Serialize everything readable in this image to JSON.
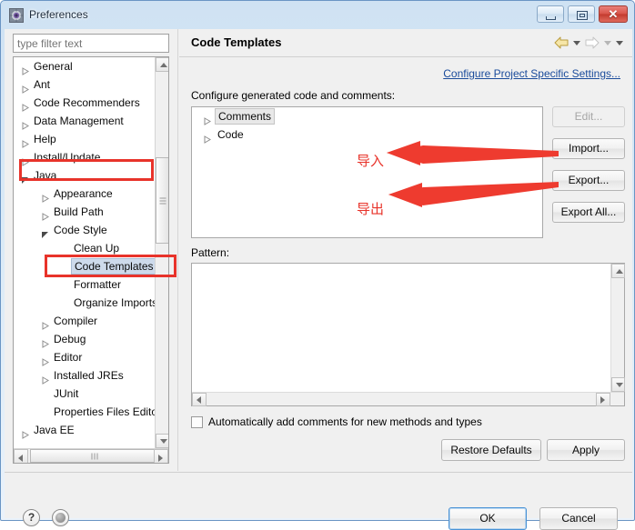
{
  "window": {
    "title": "Preferences",
    "icon": "preferences-gear-icon",
    "controls": {
      "minimize": "minimize-button",
      "maximize": "maximize-button",
      "close": "✕"
    }
  },
  "sidebar": {
    "filter": {
      "value": "",
      "placeholder": "type filter text"
    },
    "tree": [
      {
        "label": "General",
        "indent": 0,
        "state": "collapsed",
        "selected": false
      },
      {
        "label": "Ant",
        "indent": 0,
        "state": "collapsed",
        "selected": false
      },
      {
        "label": "Code Recommenders",
        "indent": 0,
        "state": "collapsed",
        "selected": false
      },
      {
        "label": "Data Management",
        "indent": 0,
        "state": "collapsed",
        "selected": false
      },
      {
        "label": "Help",
        "indent": 0,
        "state": "collapsed",
        "selected": false
      },
      {
        "label": "Install/Update",
        "indent": 0,
        "state": "collapsed",
        "selected": false
      },
      {
        "label": "Java",
        "indent": 0,
        "state": "expanded",
        "selected": false
      },
      {
        "label": "Appearance",
        "indent": 1,
        "state": "collapsed",
        "selected": false
      },
      {
        "label": "Build Path",
        "indent": 1,
        "state": "collapsed",
        "selected": false
      },
      {
        "label": "Code Style",
        "indent": 1,
        "state": "expanded",
        "selected": false
      },
      {
        "label": "Clean Up",
        "indent": 2,
        "state": "leaf",
        "selected": false
      },
      {
        "label": "Code Templates",
        "indent": 2,
        "state": "leaf",
        "selected": true
      },
      {
        "label": "Formatter",
        "indent": 2,
        "state": "leaf",
        "selected": false
      },
      {
        "label": "Organize Imports",
        "indent": 2,
        "state": "leaf",
        "selected": false
      },
      {
        "label": "Compiler",
        "indent": 1,
        "state": "collapsed",
        "selected": false
      },
      {
        "label": "Debug",
        "indent": 1,
        "state": "collapsed",
        "selected": false
      },
      {
        "label": "Editor",
        "indent": 1,
        "state": "collapsed",
        "selected": false
      },
      {
        "label": "Installed JREs",
        "indent": 1,
        "state": "collapsed",
        "selected": false
      },
      {
        "label": "JUnit",
        "indent": 1,
        "state": "leaf",
        "selected": false
      },
      {
        "label": "Properties Files Editor",
        "indent": 1,
        "state": "leaf",
        "selected": false
      },
      {
        "label": "Java EE",
        "indent": 0,
        "state": "collapsed",
        "selected": false
      }
    ]
  },
  "page": {
    "title": "Code Templates",
    "nav": {
      "back": "back-arrow",
      "back_menu": "back-dropdown",
      "forward": "forward-arrow",
      "forward_menu": "forward-dropdown",
      "view_menu": "view-menu"
    },
    "project_link": "Configure Project Specific Settings...",
    "caption": "Configure generated code and comments:",
    "list": [
      {
        "label": "Comments",
        "state": "collapsed",
        "selected": true
      },
      {
        "label": "Code",
        "state": "collapsed",
        "selected": false
      }
    ],
    "buttons": {
      "edit": {
        "label": "Edit...",
        "enabled": false
      },
      "import": {
        "label": "Import...",
        "enabled": true
      },
      "export": {
        "label": "Export...",
        "enabled": true
      },
      "export_all": {
        "label": "Export All...",
        "enabled": true
      }
    },
    "pattern": {
      "label": "Pattern:",
      "value": ""
    },
    "auto_comments": {
      "label": "Automatically add comments for new methods and types",
      "checked": false
    },
    "restore_defaults": "Restore Defaults",
    "apply": "Apply"
  },
  "footer": {
    "help_icon": "?",
    "globe_icon": "globe-icon",
    "ok": "OK",
    "cancel": "Cancel"
  },
  "annotations": {
    "color": "#e8332a",
    "import_label": "导入",
    "export_label": "导出",
    "boxed_tree_items": [
      "Java",
      "Code Templates"
    ]
  }
}
